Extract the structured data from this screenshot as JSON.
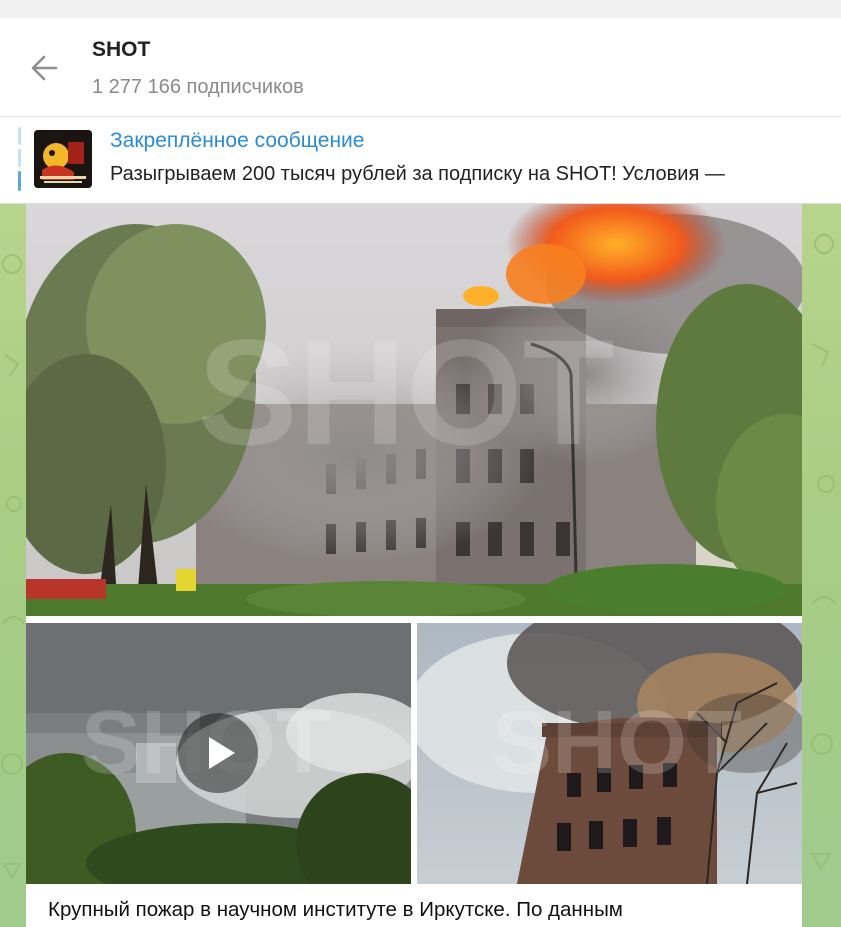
{
  "channel": {
    "title": "SHOT",
    "subscribers": "1 277 166 подписчиков"
  },
  "pinned": {
    "title": "Закреплённое сообщение",
    "text": "Разыгрываем 200 тысяч рублей за подписку на SHOT! Условия —"
  },
  "post": {
    "watermark": "SHOT",
    "caption": "Крупный пожар в научном институте в Иркутске. По данным"
  },
  "icons": {
    "back": "arrow-left-icon",
    "play": "play-icon"
  },
  "colors": {
    "accent": "#2a8bd6",
    "chat_background": "#a9cd84"
  }
}
